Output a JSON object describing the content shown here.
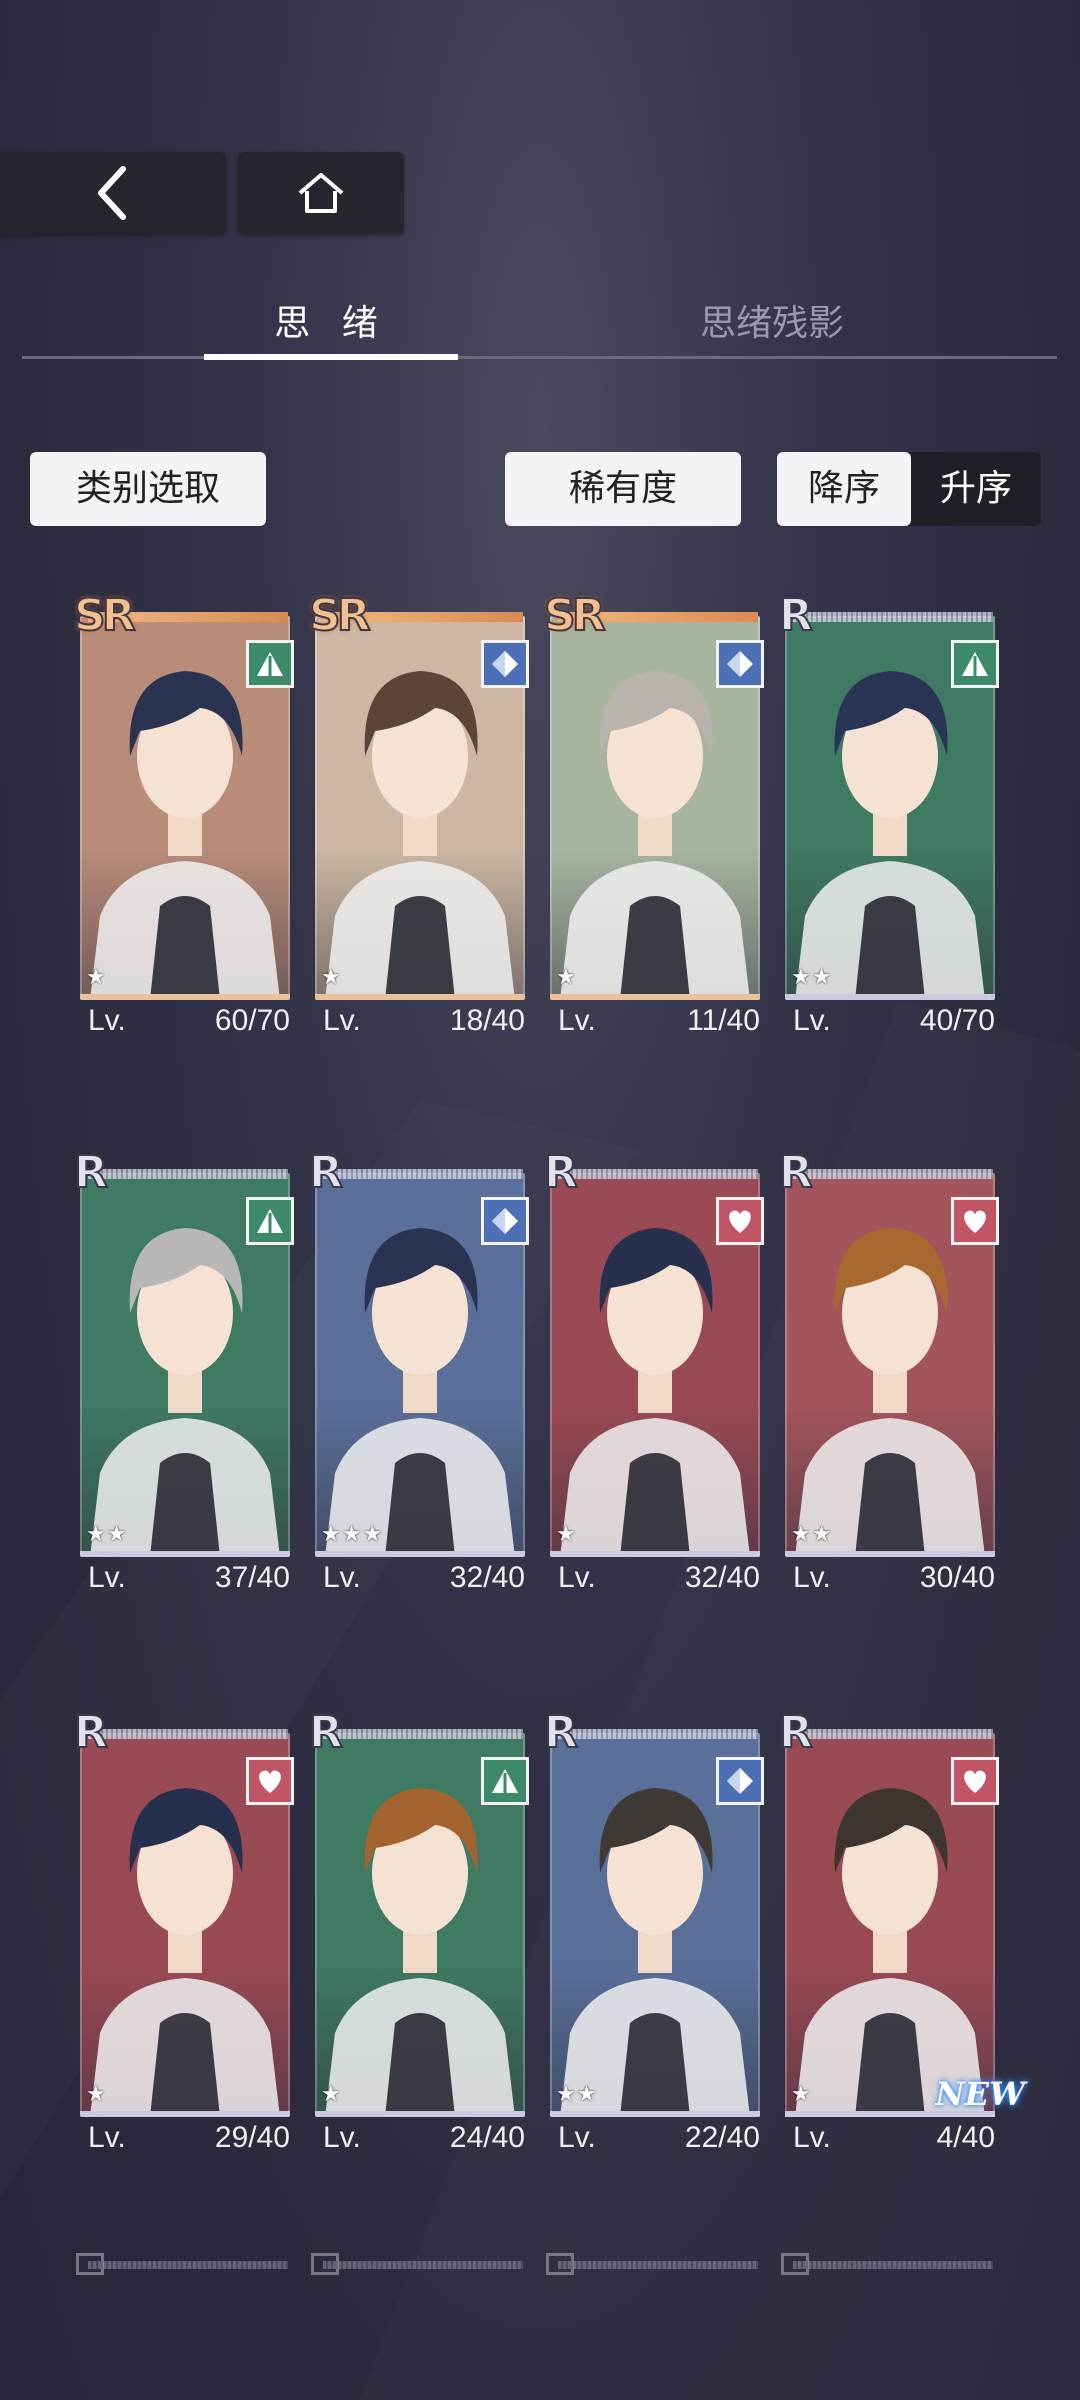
{
  "tabs": [
    {
      "label": "思 绪"
    },
    {
      "label": "思绪残影"
    }
  ],
  "filters": {
    "category": "类别选取",
    "rarity": "稀有度",
    "sort_desc": "降序",
    "sort_asc": "升序"
  },
  "level_prefix": "Lv.",
  "cards": [
    {
      "rarity": "SR",
      "attribute": "green-triangle-icon",
      "stars": "★",
      "level": "60/70",
      "bg": "#b98c7a",
      "hair": "#2a3450"
    },
    {
      "rarity": "SR",
      "attribute": "blue-diamond-icon",
      "stars": "★",
      "level": "18/40",
      "bg": "#cbb7a2",
      "hair": "#5a4536"
    },
    {
      "rarity": "SR",
      "attribute": "blue-diamond-icon",
      "stars": "★",
      "level": "11/40",
      "bg": "#a7b5a0",
      "hair": "#b9b3ad"
    },
    {
      "rarity": "R",
      "attribute": "green-triangle-icon",
      "stars": "★★",
      "level": "40/70",
      "bg": "#3f7a62",
      "hair": "#2a3556"
    },
    {
      "rarity": "R",
      "attribute": "green-triangle-icon",
      "stars": "★★",
      "level": "37/40",
      "bg": "#3f7a62",
      "hair": "#b9b6b6"
    },
    {
      "rarity": "R",
      "attribute": "blue-diamond-icon",
      "stars": "★★★",
      "level": "32/40",
      "bg": "#5a6f9a",
      "hair": "#2a3452"
    },
    {
      "rarity": "R",
      "attribute": "pink-heart-icon",
      "stars": "★",
      "level": "32/40",
      "bg": "#9a4a55",
      "hair": "#27304d"
    },
    {
      "rarity": "R",
      "attribute": "pink-heart-icon",
      "stars": "★★",
      "level": "30/40",
      "bg": "#a3555d",
      "hair": "#a8692e"
    },
    {
      "rarity": "R",
      "attribute": "pink-heart-icon",
      "stars": "★",
      "level": "29/40",
      "bg": "#9a4a55",
      "hair": "#26304c"
    },
    {
      "rarity": "R",
      "attribute": "green-triangle-icon",
      "stars": "★",
      "level": "24/40",
      "bg": "#3f7a62",
      "hair": "#a3642f"
    },
    {
      "rarity": "R",
      "attribute": "blue-diamond-icon",
      "stars": "★★",
      "level": "22/40",
      "bg": "#5a6f9a",
      "hair": "#3f3a36"
    },
    {
      "rarity": "R",
      "attribute": "pink-heart-icon",
      "stars": "★",
      "level": "4/40",
      "bg": "#9a4a55",
      "hair": "#3f3530",
      "new": "NEW"
    }
  ]
}
